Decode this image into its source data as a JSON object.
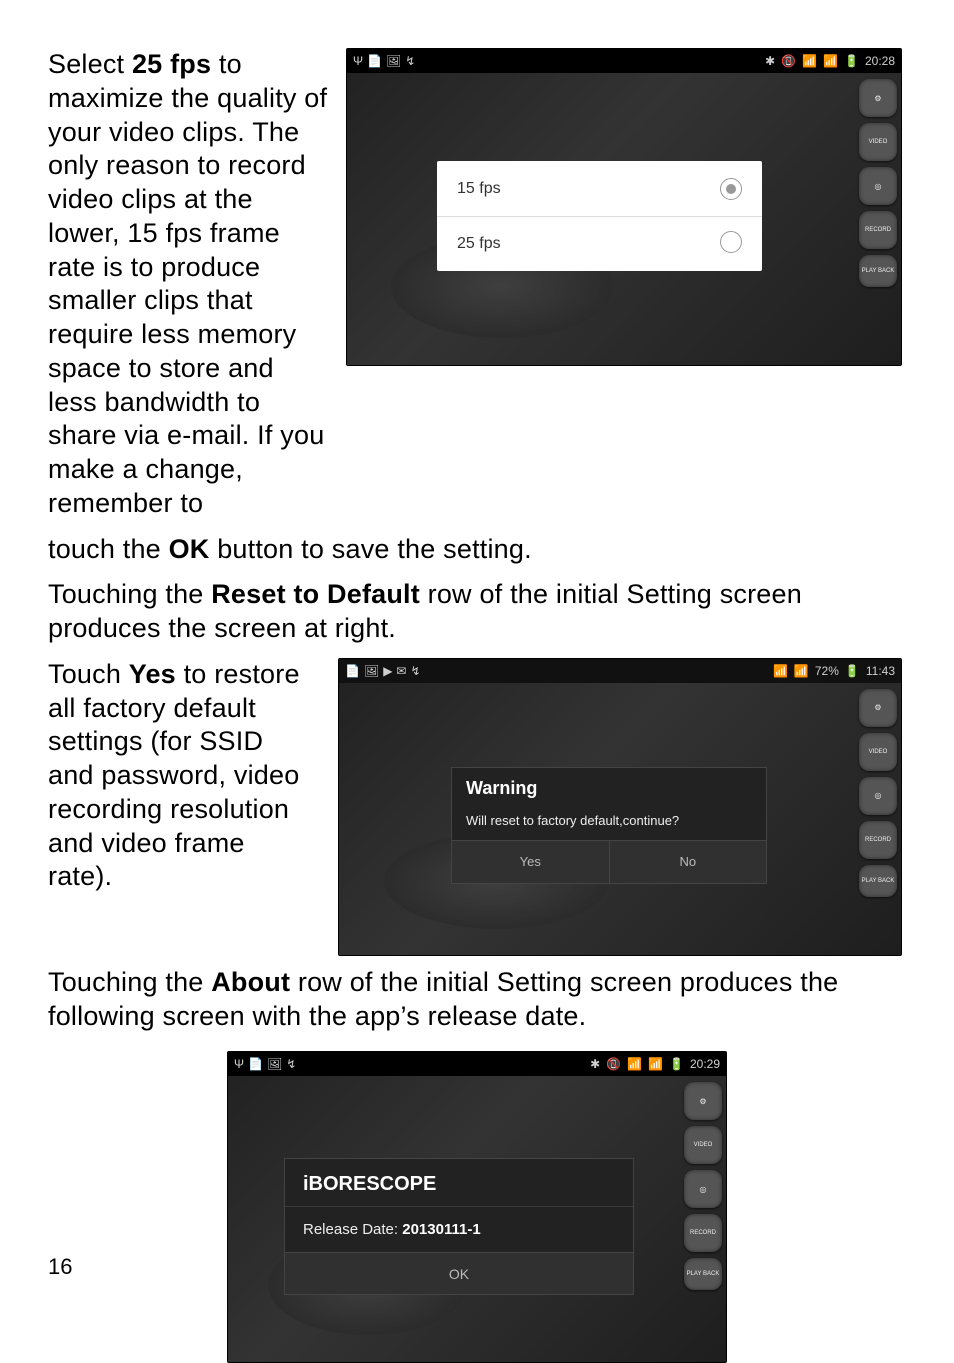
{
  "page_number": "16",
  "para1_lead": "Select ",
  "para1_bold1": "25 fps",
  "para1_body": " to maximize the quality of your video clips. The only reason to record video clips at the lower, 15 fps frame rate is to produce smaller clips that require less memory space to store and less bandwidth to share via e-mail. If you make a change, remember to touch the ",
  "para1_bold2": "OK",
  "para1_tail": " button to save the setting.",
  "para2_lead": "Touching the ",
  "para2_bold": "Reset to Default",
  "para2_tail": " row of the initial Setting screen produces the screen at right.",
  "para3_lead": "Touch ",
  "para3_bold": "Yes",
  "para3_tail": " to restore all factory default settings (for SSID and password, video recording resolution and video frame rate).",
  "para4_lead": "Touching the ",
  "para4_bold": "About",
  "para4_tail": " row of the initial Setting screen produces the following screen with the app’s release date.",
  "shot1": {
    "status_left": [
      "Ψ",
      "📄",
      "🖼",
      "↯"
    ],
    "status_right": [
      "✱",
      "📵",
      "📶",
      "📶",
      "🔋"
    ],
    "time": "20:28",
    "fps_options": [
      {
        "label": "15 fps",
        "selected": true
      },
      {
        "label": "25 fps",
        "selected": false
      }
    ],
    "side_icons": [
      "gear",
      "VIDEO",
      "shot",
      "RECORD",
      "PLAY BACK"
    ]
  },
  "shot2": {
    "status_left": [
      "📄",
      "🖼",
      "▶",
      "✉",
      "↯"
    ],
    "status_right": [
      "📶",
      "📶",
      "72%",
      "🔋"
    ],
    "time": "11:43",
    "dialog_title": "Warning",
    "dialog_body": "Will reset to factory default,continue?",
    "btn_yes": "Yes",
    "btn_no": "No",
    "side_icons": [
      "gear",
      "VIDEO",
      "shot",
      "RECORD",
      "PLAY BACK"
    ]
  },
  "shot3": {
    "status_left": [
      "Ψ",
      "📄",
      "🖼",
      "↯"
    ],
    "status_right": [
      "✱",
      "📵",
      "📶",
      "📶",
      "🔋"
    ],
    "time": "20:29",
    "dialog_title": "iBORESCOPE",
    "body_label": "Release Date: ",
    "body_value": "20130111-1",
    "btn_ok": "OK",
    "side_icons": [
      "gear",
      "VIDEO",
      "shot",
      "RECORD",
      "PLAY BACK"
    ]
  }
}
